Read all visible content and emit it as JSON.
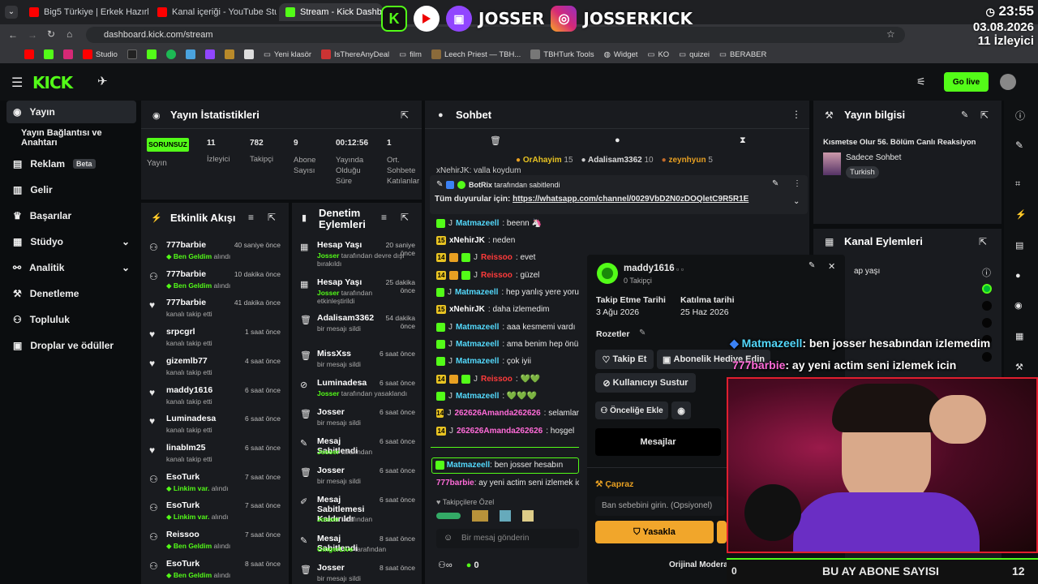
{
  "browser": {
    "tabs": [
      {
        "label": "Big5 Türkiye | Erkek Hazırlık Se"
      },
      {
        "label": "Kanal içeriği - YouTube Studio"
      },
      {
        "label": "Stream - Kick Dashboard"
      }
    ],
    "url": "dashboard.kick.com/stream",
    "bookmarks": [
      "Studio",
      "Yeni klasör",
      "IsThereAnyDeal",
      "film",
      "Leech Priest — TBH...",
      "TBHTurk Tools",
      "Widget",
      "KO",
      "quizei",
      "BERABER"
    ]
  },
  "overlay": {
    "twitch_name": "JOSSER",
    "instagram_name": "JOSSERKICK",
    "time": "23:55",
    "date": "03.08.2026",
    "viewers": "11 İzleyici",
    "chat1_user": "Matmazeell",
    "chat1_text": ": ben josser hesabından izlemedim",
    "chat2_user": "777barbie",
    "chat2_text": ": ay yeni actim seni izlemek icin",
    "bottom_left": "0",
    "bottom_title": "BU AY ABONE SAYISI",
    "bottom_right": "12"
  },
  "header": {
    "go_live": "Go live",
    "logo": "KICK"
  },
  "sidebar": {
    "items": [
      {
        "label": "Yayın"
      },
      {
        "label": "Yayın Bağlantısı ve Anahtarı"
      },
      {
        "label": "Reklam",
        "badge": "Beta"
      },
      {
        "label": "Gelir"
      },
      {
        "label": "Başarılar"
      },
      {
        "label": "Stüdyo"
      },
      {
        "label": "Analitik"
      },
      {
        "label": "Denetleme"
      },
      {
        "label": "Topluluk"
      },
      {
        "label": "Droplar ve ödüller"
      }
    ]
  },
  "stats": {
    "title": "Yayın İstatistikleri",
    "status": "SORUNSUZ",
    "status_label": "Yayın",
    "viewers": "11",
    "viewers_label": "İzleyici",
    "followers": "782",
    "followers_label": "Takipçi",
    "subs": "9",
    "subs_label": "Abone Sayısı",
    "uptime": "00:12:56",
    "uptime_label": "Yayında Olduğu Süre",
    "avg": "1",
    "avg_label": "Ort. Sohbete Katılanlar"
  },
  "activity": {
    "title": "Etkinlik Akışı",
    "items": [
      {
        "name": "777barbie",
        "sub": "Ben Geldim",
        "sub2": " alındı",
        "time": "40 saniye önce",
        "green": true
      },
      {
        "name": "777barbie",
        "sub": "Ben Geldim",
        "sub2": " alındı",
        "time": "10 dakika önce",
        "green": true
      },
      {
        "name": "777barbie",
        "sub": "",
        "sub2": "kanalı takip etti",
        "time": "41 dakika önce",
        "green": false
      },
      {
        "name": "srpcgrl",
        "sub": "",
        "sub2": "kanalı takip etti",
        "time": "1 saat önce",
        "green": false
      },
      {
        "name": "gizemlb77",
        "sub": "",
        "sub2": "kanalı takip etti",
        "time": "4 saat önce",
        "green": false
      },
      {
        "name": "maddy1616",
        "sub": "",
        "sub2": "kanalı takip etti",
        "time": "6 saat önce",
        "green": false
      },
      {
        "name": "Luminadesa",
        "sub": "",
        "sub2": "kanalı takip etti",
        "time": "6 saat önce",
        "green": false
      },
      {
        "name": "linablm25",
        "sub": "",
        "sub2": "kanalı takip etti",
        "time": "6 saat önce",
        "green": false
      },
      {
        "name": "EsoTurk",
        "sub": "Linkim var.",
        "sub2": " alındı",
        "time": "7 saat önce",
        "green": true
      },
      {
        "name": "EsoTurk",
        "sub": "Linkim var.",
        "sub2": " alındı",
        "time": "7 saat önce",
        "green": true
      },
      {
        "name": "Reissoo",
        "sub": "Ben Geldim",
        "sub2": " alındı",
        "time": "7 saat önce",
        "green": true
      },
      {
        "name": "EsoTurk",
        "sub": "Ben Geldim",
        "sub2": " alındı",
        "time": "8 saat önce",
        "green": true
      }
    ]
  },
  "moderation": {
    "title": "Denetim Eylemleri",
    "items": [
      {
        "name": "Hesap Yaşı",
        "sub": "Josser",
        "sub2": " tarafından devre dışı bırakıldı",
        "time": "20 saniye önce"
      },
      {
        "name": "Hesap Yaşı",
        "sub": "Josser",
        "sub2": " tarafından etkinleştirildi",
        "time": "25 dakika önce"
      },
      {
        "name": "Adalisam3362",
        "sub": "",
        "sub2": "bir mesajı sildi",
        "time": "54 dakika önce"
      },
      {
        "name": "MissXss",
        "sub": "",
        "sub2": "bir mesajı sildi",
        "time": "6 saat önce"
      },
      {
        "name": "Luminadesa",
        "sub": "Josser",
        "sub2": " tarafından yasaklandı",
        "time": "6 saat önce"
      },
      {
        "name": "Josser",
        "sub": "",
        "sub2": "bir mesajı sildi",
        "time": "6 saat önce"
      },
      {
        "name": "Mesaj Sabitlendi",
        "sub": "Josser",
        "sub2": " tarafından",
        "time": "6 saat önce"
      },
      {
        "name": "Josser",
        "sub": "",
        "sub2": "bir mesajı sildi",
        "time": "6 saat önce"
      },
      {
        "name": "Mesaj Sabitlemesi Kaldırıldı",
        "sub": "Josser",
        "sub2": " tarafından",
        "time": "6 saat önce"
      },
      {
        "name": "Mesaj Sabitlendi",
        "sub": "GingerLive",
        "sub2": " tarafından",
        "time": "8 saat önce"
      },
      {
        "name": "Josser",
        "sub": "",
        "sub2": "bir mesajı sildi",
        "time": "8 saat önce"
      }
    ]
  },
  "chat": {
    "title": "Sohbet",
    "top": [
      {
        "name": "OrAhayim",
        "count": "15"
      },
      {
        "name": "Adalisam3362",
        "count": "10"
      },
      {
        "name": "zeynhyun",
        "count": "5"
      }
    ],
    "scrolled": "xNehirJK: valla koydum",
    "pinned_by": "BotRix",
    "pinned_label": " tarafından sabitlendi",
    "pinned_prefix": "Tüm duyurular için: ",
    "pinned_link": "https://whatsapp.com/channel/0029VbD2N0zDOQletC9R5R1E",
    "messages": [
      {
        "user": "Matmazeell",
        "text": ": beenn 🦄",
        "color": "#53d8fb",
        "b": "g"
      },
      {
        "user": "xNehirJK",
        "text": ": neden",
        "color": "#ffffff",
        "b": "15"
      },
      {
        "user": "Reissoo",
        "text": ": evet",
        "color": "#ff3b3b",
        "b": "14"
      },
      {
        "user": "Reissoo",
        "text": ": güzel",
        "color": "#ff3b3b",
        "b": "14"
      },
      {
        "user": "Matmazeell",
        "text": ": hep yanlış yere yoru",
        "color": "#53d8fb",
        "b": "g"
      },
      {
        "user": "xNehirJK",
        "text": ": daha izlemedim",
        "color": "#ffffff",
        "b": "15"
      },
      {
        "user": "Matmazeell",
        "text": ": aaa kesmemi vardı",
        "color": "#53d8fb",
        "b": "g"
      },
      {
        "user": "Matmazeell",
        "text": ": ama benim hep önü",
        "color": "#53d8fb",
        "b": "g"
      },
      {
        "user": "Matmazeell",
        "text": ": çok iyii",
        "color": "#53d8fb",
        "b": "g"
      },
      {
        "user": "Reissoo",
        "text": ": 💚💚",
        "color": "#ff3b3b",
        "b": "14"
      },
      {
        "user": "Matmazeell",
        "text": ": 💚💚💚",
        "color": "#53d8fb",
        "b": "g"
      },
      {
        "user": "262626Amanda262626",
        "text": ": selamlar",
        "color": "#ff6bd8",
        "b": "14"
      },
      {
        "user": "262626Amanda262626",
        "text": ": hoşgel",
        "color": "#ff6bd8",
        "b": "14"
      }
    ],
    "reply_user": "Matmazeell",
    "reply_text": ": ben josser hesabın",
    "reply2_user": "777barbie",
    "reply2_text": ": ay yeni actim seni izlemek ic",
    "followers_only": "Takipçilere Özel",
    "input_placeholder": "Bir mesaj gönderin",
    "footer_count": "0"
  },
  "usercard": {
    "name": "maddy1616",
    "followers": "0 Takipçi",
    "follow_date_label": "Takip Etme Tarihi",
    "follow_date": "3 Ağu 2026",
    "join_date_label": "Katılma tarihi",
    "join_date": "25 Haz 2026",
    "badges_label": "Rozetler",
    "follow_btn": "Takip Et",
    "gift_btn": "Abonelik Hediye Edin",
    "mute_btn": "Kullanıcıyı Sustur",
    "priority_btn": "Önceliğe Ekle",
    "messages_btn": "Mesajlar",
    "ban_title": "Çapraz",
    "ban_placeholder": "Ban sebebini girin. (Opsiyonel)",
    "ban_btn": "Yasakla",
    "mod_view": "Orijinal Moderasyona Geç"
  },
  "streaminfo": {
    "title": "Yayın bilgisi",
    "stream_title": "Kısmetse Olur 56. Bölüm Canlı Reaksiyon",
    "category": "Sadece Sohbet",
    "tag": "Turkish"
  },
  "channelactions": {
    "title": "Kanal Eylemleri",
    "item": "ap yaşı"
  }
}
